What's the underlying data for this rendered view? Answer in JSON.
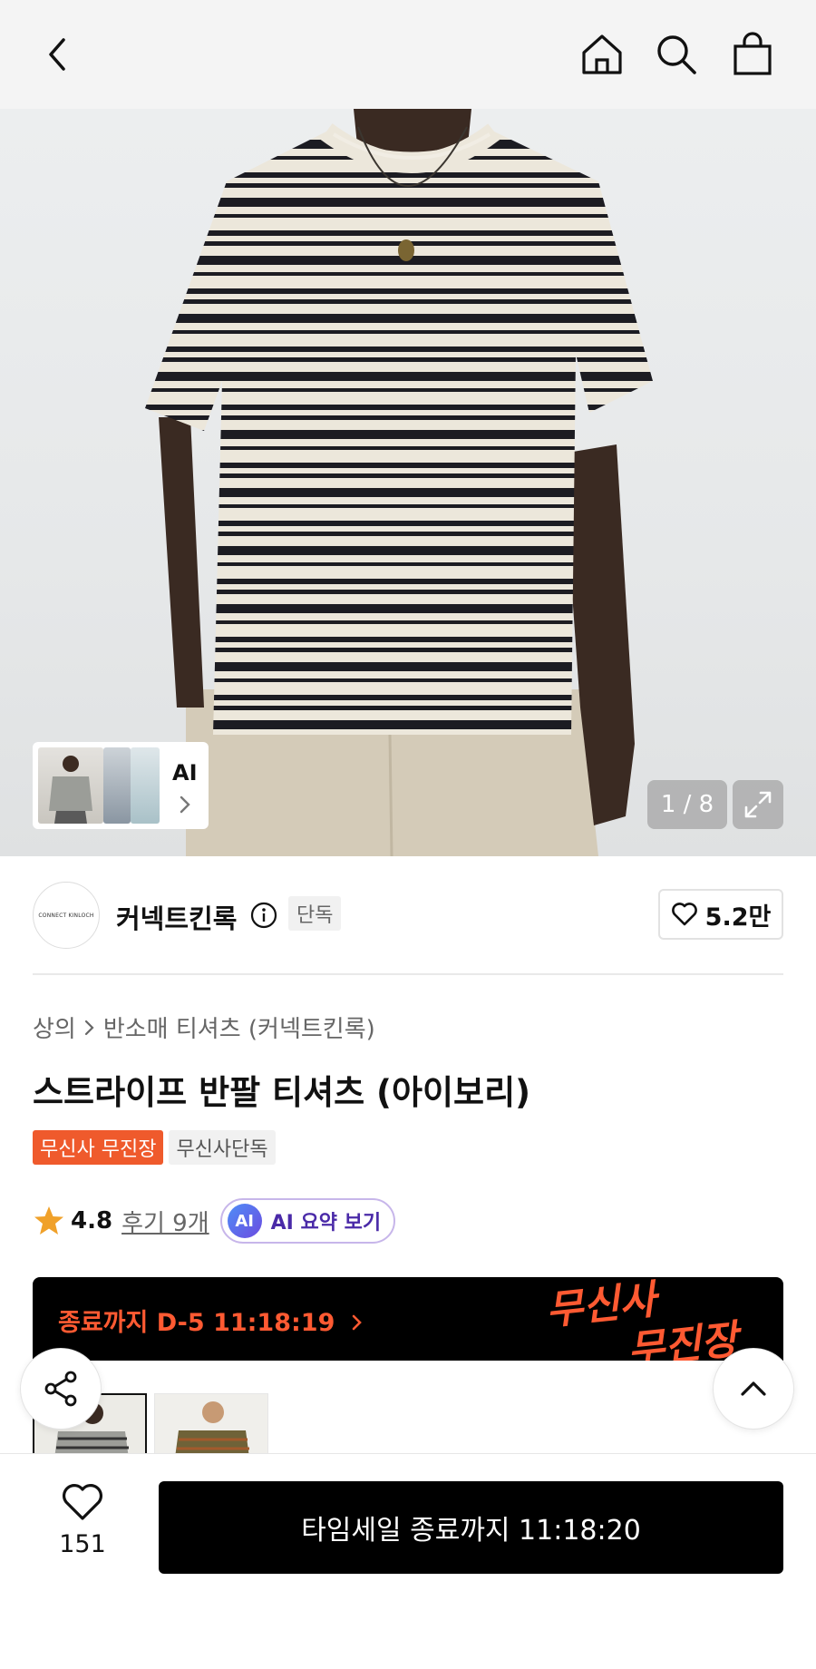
{
  "header": {
    "back_icon": "chevron-left-icon",
    "home_icon": "home-icon",
    "search_icon": "search-icon",
    "cart_icon": "shopping-bag-icon"
  },
  "gallery": {
    "counter": "1 / 8",
    "ai_label": "AI",
    "expand_icon": "expand-icon"
  },
  "brand": {
    "logo_text": "CONNECT KINLOCH",
    "name": "커넥트킨록",
    "tag": "단독",
    "likes": "5.2만"
  },
  "breadcrumb": {
    "category": "상의",
    "subcategory": "반소매 티셔츠 (커넥트킨록)"
  },
  "product": {
    "title": "스트라이프 반팔 티셔츠 (아이보리)",
    "badges": [
      "무신사 무진장",
      "무신사단독"
    ],
    "rating": "4.8",
    "review_link": "후기 9개",
    "ai_summary_icon": "AI",
    "ai_summary_label": "AI 요약 보기"
  },
  "banner": {
    "text": "종료까지 D-5 11:18:19",
    "brand_art": "무신사 무진장"
  },
  "bottom": {
    "wish_count": "151",
    "buy_label": "타임세일 종료까지 11:18:20"
  },
  "colors": {
    "accent": "#ef5a2c",
    "banner_text": "#ff5a32",
    "ai_purple": "#4a2aa8"
  }
}
